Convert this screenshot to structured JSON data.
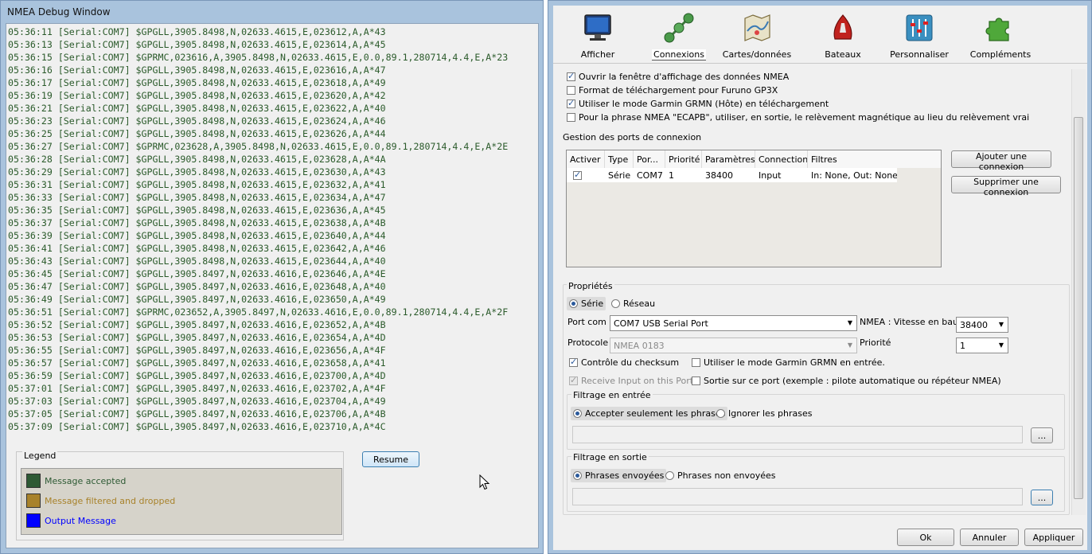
{
  "nmea_window": {
    "title": "NMEA Debug Window",
    "log_lines": [
      "05:36:11 [Serial:COM7] $GPGLL,3905.8498,N,02633.4615,E,023612,A,A*43",
      "05:36:13 [Serial:COM7] $GPGLL,3905.8498,N,02633.4615,E,023614,A,A*45",
      "05:36:15 [Serial:COM7] $GPRMC,023616,A,3905.8498,N,02633.4615,E,0.0,89.1,280714,4.4,E,A*23",
      "05:36:16 [Serial:COM7] $GPGLL,3905.8498,N,02633.4615,E,023616,A,A*47",
      "05:36:17 [Serial:COM7] $GPGLL,3905.8498,N,02633.4615,E,023618,A,A*49",
      "05:36:19 [Serial:COM7] $GPGLL,3905.8498,N,02633.4615,E,023620,A,A*42",
      "05:36:21 [Serial:COM7] $GPGLL,3905.8498,N,02633.4615,E,023622,A,A*40",
      "05:36:23 [Serial:COM7] $GPGLL,3905.8498,N,02633.4615,E,023624,A,A*46",
      "05:36:25 [Serial:COM7] $GPGLL,3905.8498,N,02633.4615,E,023626,A,A*44",
      "05:36:27 [Serial:COM7] $GPRMC,023628,A,3905.8498,N,02633.4615,E,0.0,89.1,280714,4.4,E,A*2E",
      "05:36:28 [Serial:COM7] $GPGLL,3905.8498,N,02633.4615,E,023628,A,A*4A",
      "05:36:29 [Serial:COM7] $GPGLL,3905.8498,N,02633.4615,E,023630,A,A*43",
      "05:36:31 [Serial:COM7] $GPGLL,3905.8498,N,02633.4615,E,023632,A,A*41",
      "05:36:33 [Serial:COM7] $GPGLL,3905.8498,N,02633.4615,E,023634,A,A*47",
      "05:36:35 [Serial:COM7] $GPGLL,3905.8498,N,02633.4615,E,023636,A,A*45",
      "05:36:37 [Serial:COM7] $GPGLL,3905.8498,N,02633.4615,E,023638,A,A*4B",
      "05:36:39 [Serial:COM7] $GPGLL,3905.8498,N,02633.4615,E,023640,A,A*44",
      "05:36:41 [Serial:COM7] $GPGLL,3905.8498,N,02633.4615,E,023642,A,A*46",
      "05:36:43 [Serial:COM7] $GPGLL,3905.8498,N,02633.4615,E,023644,A,A*40",
      "05:36:45 [Serial:COM7] $GPGLL,3905.8497,N,02633.4616,E,023646,A,A*4E",
      "05:36:47 [Serial:COM7] $GPGLL,3905.8497,N,02633.4616,E,023648,A,A*40",
      "05:36:49 [Serial:COM7] $GPGLL,3905.8497,N,02633.4616,E,023650,A,A*49",
      "05:36:51 [Serial:COM7] $GPRMC,023652,A,3905.8497,N,02633.4616,E,0.0,89.1,280714,4.4,E,A*2F",
      "05:36:52 [Serial:COM7] $GPGLL,3905.8497,N,02633.4616,E,023652,A,A*4B",
      "05:36:53 [Serial:COM7] $GPGLL,3905.8497,N,02633.4616,E,023654,A,A*4D",
      "05:36:55 [Serial:COM7] $GPGLL,3905.8497,N,02633.4616,E,023656,A,A*4F",
      "05:36:57 [Serial:COM7] $GPGLL,3905.8497,N,02633.4616,E,023658,A,A*41",
      "05:36:59 [Serial:COM7] $GPGLL,3905.8497,N,02633.4616,E,023700,A,A*4D",
      "05:37:01 [Serial:COM7] $GPGLL,3905.8497,N,02633.4616,E,023702,A,A*4F",
      "05:37:03 [Serial:COM7] $GPGLL,3905.8497,N,02633.4616,E,023704,A,A*49",
      "05:37:05 [Serial:COM7] $GPGLL,3905.8497,N,02633.4616,E,023706,A,A*4B",
      "05:37:09 [Serial:COM7] $GPGLL,3905.8497,N,02633.4616,E,023710,A,A*4C"
    ],
    "log_color": "#2a5a2a",
    "resume_label": "Resume",
    "legend": {
      "title": "Legend",
      "items": [
        {
          "label": "Message accepted",
          "color": "#2e5a34"
        },
        {
          "label": "Message filtered and dropped",
          "color": "#a8822a"
        },
        {
          "label": "Output Message",
          "color": "#0000ff"
        }
      ]
    }
  },
  "options_window": {
    "toolbar": [
      {
        "label": "Afficher",
        "icon": "monitor-icon"
      },
      {
        "label": "Connexions",
        "icon": "connections-icon",
        "active": true
      },
      {
        "label": "Cartes/données",
        "icon": "charts-icon"
      },
      {
        "label": "Bateaux",
        "icon": "boat-icon"
      },
      {
        "label": "Personnaliser",
        "icon": "sliders-icon"
      },
      {
        "label": "Compléments",
        "icon": "puzzle-icon"
      }
    ],
    "general_options": [
      {
        "label": "Ouvrir la fenêtre d'affichage des données NMEA",
        "checked": true
      },
      {
        "label": "Format de téléchargement pour Furuno GP3X",
        "checked": false
      },
      {
        "label": "Utiliser le mode Garmin GRMN (Hôte) en téléchargement",
        "checked": true
      },
      {
        "label": "Pour la phrase NMEA \"ECAPB\", utiliser, en sortie, le relèvement magnétique  au lieu du relèvement vrai",
        "checked": false
      }
    ],
    "ports_section_title": "Gestion des ports de connexion",
    "grid": {
      "headers": [
        "Activer",
        "Type",
        "Por...",
        "Priorité",
        "Paramètres",
        "Connection",
        "Filtres"
      ],
      "row": {
        "enabled": true,
        "type": "Série",
        "port": "COM7",
        "priority": "1",
        "params": "38400",
        "connection": "Input",
        "filters": "In: None, Out: None"
      }
    },
    "add_connection_label": "Ajouter une connexion",
    "remove_connection_label": "Supprimer une connexion",
    "properties": {
      "title": "Propriétés",
      "type_serial": "Série",
      "type_network": "Réseau",
      "port_label": "Port com",
      "port_value": "COM7 USB Serial Port",
      "baud_label": "NMEA : Vitesse en baud",
      "baud_value": "38400",
      "protocol_label": "Protocole",
      "protocol_value": "NMEA 0183",
      "priority_label": "Priorité",
      "priority_value": "1",
      "checksum_label": "Contrôle du checksum",
      "garmin_input_label": "Utiliser le mode Garmin GRMN en entrée.",
      "receive_label": "Receive Input on this Port",
      "output_label": "Sortie sur ce port (exemple : pilote automatique ou répéteur NMEA)"
    },
    "input_filter": {
      "title": "Filtrage en entrée",
      "accept": "Accepter seulement les phrases",
      "ignore": "Ignorer les phrases",
      "browse": "..."
    },
    "output_filter": {
      "title": "Filtrage en sortie",
      "sent": "Phrases envoyées",
      "not_sent": "Phrases non envoyées",
      "browse": "..."
    },
    "buttons": {
      "ok": "Ok",
      "cancel": "Annuler",
      "apply": "Appliquer"
    }
  }
}
